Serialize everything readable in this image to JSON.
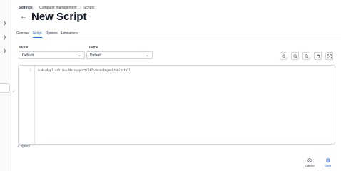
{
  "breadcrumb": {
    "items": [
      "Settings",
      "Computer management",
      "Scripts"
    ],
    "separator": "/"
  },
  "page": {
    "title": "New Script",
    "back_icon": "arrow-left-icon"
  },
  "tabs": [
    {
      "label": "General",
      "active": false
    },
    {
      "label": "Script",
      "active": true
    },
    {
      "label": "Options",
      "active": false
    },
    {
      "label": "Limitations",
      "active": false
    }
  ],
  "mode": {
    "label": "Mode",
    "value": "Default"
  },
  "theme": {
    "label": "Theme",
    "value": "Default"
  },
  "toolbar": {
    "icons": [
      "zoom-in-icon",
      "zoom-out-icon",
      "search-icon",
      "delete-icon",
      "fullscreen-icon"
    ]
  },
  "editor": {
    "line_numbers": [
      "1"
    ],
    "lines": [
      "sudo/Applications/Netsupport/247connectAgent/uninstall"
    ]
  },
  "status": {
    "copied_text": "Copied!"
  },
  "actions": {
    "cancel_label": "Cancel",
    "save_label": "Save"
  },
  "colors": {
    "accent": "#2563eb",
    "border": "#d1d5db",
    "text": "#1f2937"
  }
}
